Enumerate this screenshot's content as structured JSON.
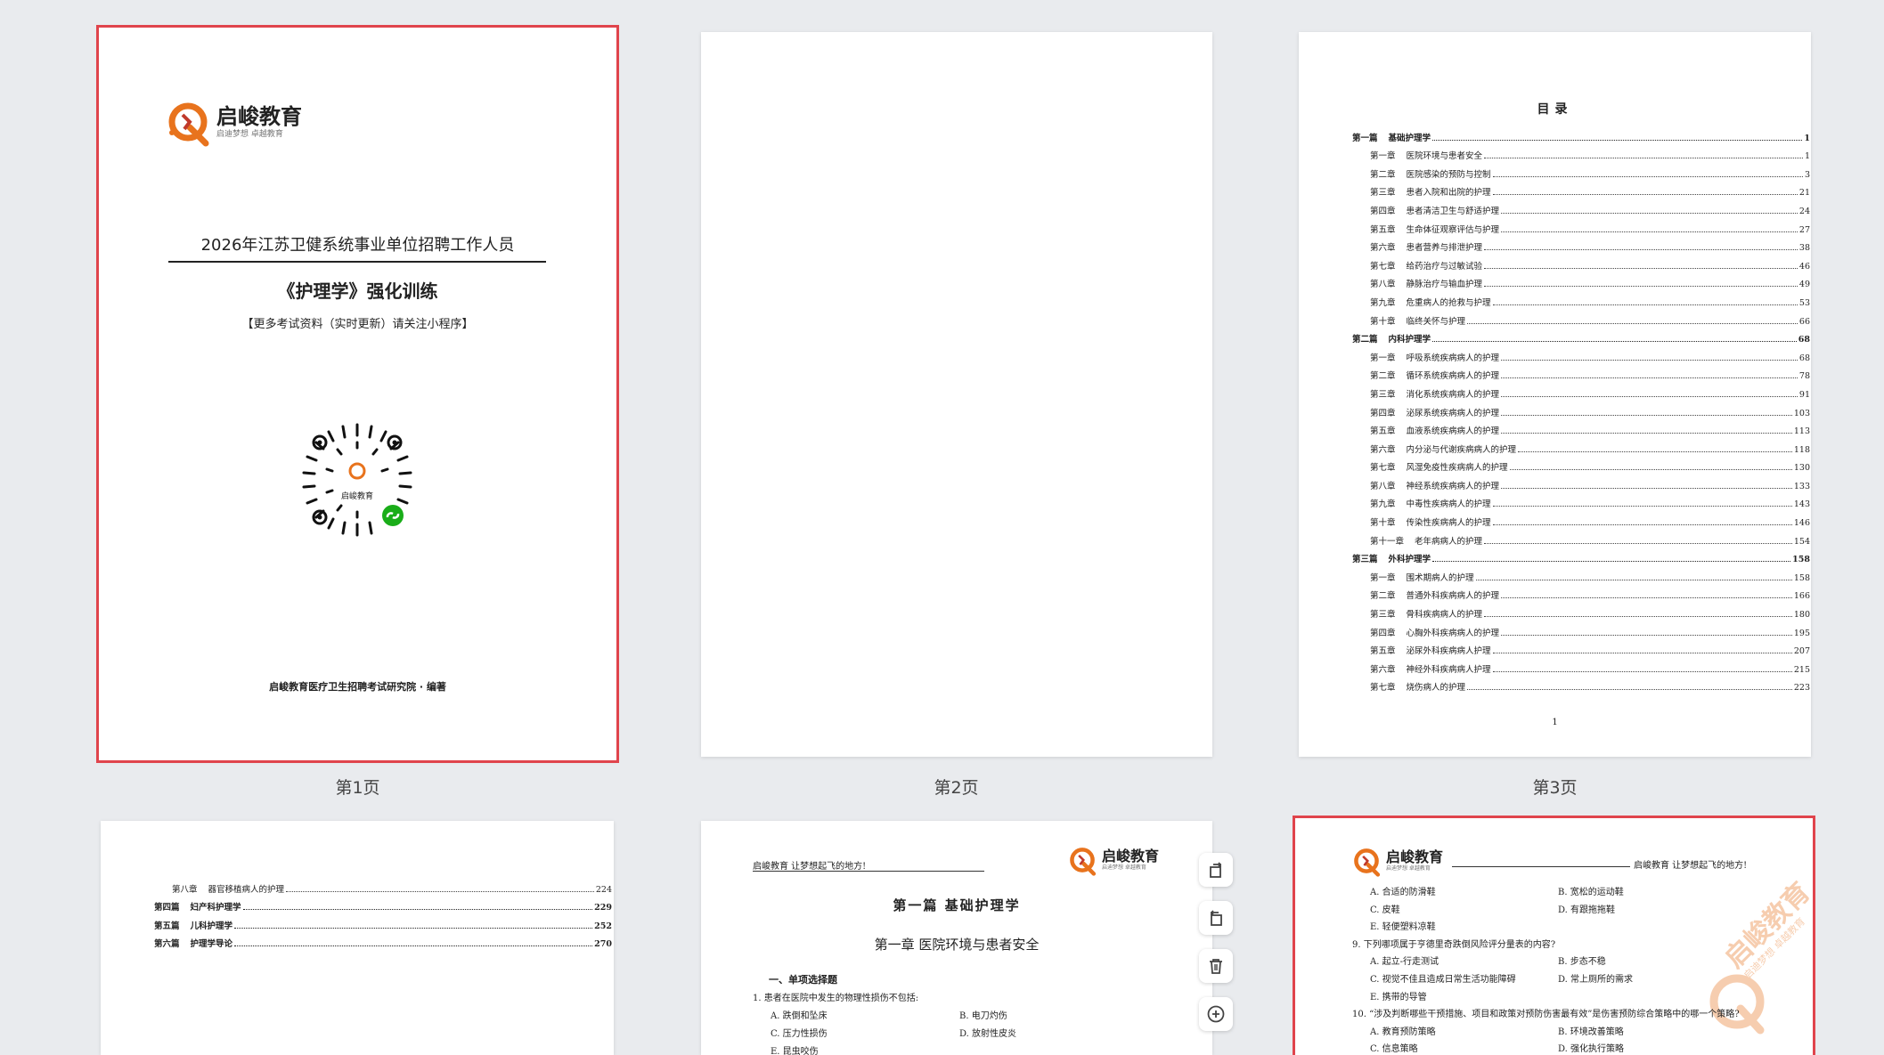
{
  "brand": {
    "name": "启峻教育",
    "slogan": "启迪梦想 卓越教育"
  },
  "pages": [
    {
      "label": "第1页"
    },
    {
      "label": "第2页"
    },
    {
      "label": "第3页"
    }
  ],
  "cover": {
    "title_line1": "2026年江苏卫健系统事业单位招聘工作人员",
    "title_line2": "《护理学》强化训练",
    "note": "【更多考试资料（实时更新）请关注小程序】",
    "qr_logo_text": "启峻教育",
    "publisher": "启峻教育医疗卫生招聘考试研究院 · 编著"
  },
  "toc": {
    "title": "目录",
    "page_number": "1",
    "entries": [
      {
        "type": "part",
        "k": "第一篇",
        "t": "基础护理学",
        "p": "1"
      },
      {
        "type": "chap",
        "k": "第一章",
        "t": "医院环境与患者安全",
        "p": "1"
      },
      {
        "type": "chap",
        "k": "第二章",
        "t": "医院感染的预防与控制",
        "p": "3"
      },
      {
        "type": "chap",
        "k": "第三章",
        "t": "患者入院和出院的护理",
        "p": "21"
      },
      {
        "type": "chap",
        "k": "第四章",
        "t": "患者清洁卫生与舒适护理",
        "p": "24"
      },
      {
        "type": "chap",
        "k": "第五章",
        "t": "生命体征观察评估与护理",
        "p": "27"
      },
      {
        "type": "chap",
        "k": "第六章",
        "t": "患者营养与排泄护理",
        "p": "38"
      },
      {
        "type": "chap",
        "k": "第七章",
        "t": "给药治疗与过敏试验",
        "p": "46"
      },
      {
        "type": "chap",
        "k": "第八章",
        "t": "静脉治疗与输血护理",
        "p": "49"
      },
      {
        "type": "chap",
        "k": "第九章",
        "t": "危重病人的抢救与护理",
        "p": "53"
      },
      {
        "type": "chap",
        "k": "第十章",
        "t": "临终关怀与护理",
        "p": "66"
      },
      {
        "type": "part",
        "k": "第二篇",
        "t": "内科护理学",
        "p": "68"
      },
      {
        "type": "chap",
        "k": "第一章",
        "t": "呼吸系统疾病病人的护理",
        "p": "68"
      },
      {
        "type": "chap",
        "k": "第二章",
        "t": "循环系统疾病病人的护理",
        "p": "78"
      },
      {
        "type": "chap",
        "k": "第三章",
        "t": "消化系统疾病病人的护理",
        "p": "91"
      },
      {
        "type": "chap",
        "k": "第四章",
        "t": "泌尿系统疾病病人的护理",
        "p": "103"
      },
      {
        "type": "chap",
        "k": "第五章",
        "t": "血液系统疾病病人的护理",
        "p": "113"
      },
      {
        "type": "chap",
        "k": "第六章",
        "t": "内分泌与代谢疾病病人的护理",
        "p": "118"
      },
      {
        "type": "chap",
        "k": "第七章",
        "t": "风湿免疫性疾病病人的护理",
        "p": "130"
      },
      {
        "type": "chap",
        "k": "第八章",
        "t": "神经系统疾病病人的护理",
        "p": "133"
      },
      {
        "type": "chap",
        "k": "第九章",
        "t": "中毒性疾病病人的护理",
        "p": "143"
      },
      {
        "type": "chap",
        "k": "第十章",
        "t": "传染性疾病病人的护理",
        "p": "146"
      },
      {
        "type": "chap",
        "k": "第十一章",
        "t": "老年病病人的护理",
        "p": "154"
      },
      {
        "type": "part",
        "k": "第三篇",
        "t": "外科护理学",
        "p": "158"
      },
      {
        "type": "chap",
        "k": "第一章",
        "t": "围术期病人的护理",
        "p": "158"
      },
      {
        "type": "chap",
        "k": "第二章",
        "t": "普通外科疾病病人的护理",
        "p": "166"
      },
      {
        "type": "chap",
        "k": "第三章",
        "t": "骨科疾病病人的护理",
        "p": "180"
      },
      {
        "type": "chap",
        "k": "第四章",
        "t": "心胸外科疾病病人的护理",
        "p": "195"
      },
      {
        "type": "chap",
        "k": "第五章",
        "t": "泌尿外科疾病病人护理",
        "p": "207"
      },
      {
        "type": "chap",
        "k": "第六章",
        "t": "神经外科疾病病人护理",
        "p": "215"
      },
      {
        "type": "chap",
        "k": "第七章",
        "t": "烧伤病人的护理",
        "p": "223"
      }
    ]
  },
  "toc2": {
    "entries": [
      {
        "type": "chap",
        "k": "第八章",
        "t": "器官移植病人的护理",
        "p": "224"
      },
      {
        "type": "part",
        "k": "第四篇",
        "t": "妇产科护理学",
        "p": "229"
      },
      {
        "type": "part",
        "k": "第五篇",
        "t": "儿科护理学",
        "p": "252"
      },
      {
        "type": "part",
        "k": "第六篇",
        "t": "护理学导论",
        "p": "270"
      }
    ]
  },
  "page5": {
    "header_slogan": "启峻教育  让梦想起飞的地方!",
    "part_title": "第一篇   基础护理学",
    "chapter_title": "第一章   医院环境与患者安全",
    "section": "一、单项选择题",
    "q1": "1.    患者在医院中发生的物理性损伤不包括:",
    "opts": [
      "A. 跌倒和坠床",
      "B. 电刀灼伤",
      "C. 压力性损伤",
      "D. 放射性皮炎",
      "E. 昆虫咬伤"
    ]
  },
  "page6": {
    "header_slogan": "启峻教育  让梦想起飞的地方!",
    "lines": [
      [
        "A. 合适的防滑鞋",
        "B. 宽松的运动鞋"
      ],
      [
        "C. 皮鞋",
        "D. 有跟拖拖鞋"
      ],
      [
        "E. 轻便塑料凉鞋",
        ""
      ],
      [
        "9.    下列哪项属于亨德里奇跌倒风险评分量表的内容?",
        ""
      ],
      [
        "A. 起立-行走测试",
        "B. 步态不稳"
      ],
      [
        "C. 视觉不佳且造成日常生活功能障碍",
        "D. 常上厕所的需求"
      ],
      [
        "E. 携带的导管",
        ""
      ],
      [
        "10.   “涉及判断哪些干预措施、项目和政策对预防伤害最有效”是伤害预防综合策略中的哪一个策略?",
        ""
      ],
      [
        "A. 教育预防策略",
        "B. 环境改善策略"
      ],
      [
        "C. 信息策略",
        "D. 强化执行策略"
      ]
    ]
  },
  "watermark_text": "启峻教育",
  "watermark_sub": "启迪梦想 卓越教育",
  "tools": [
    "rotate-left-icon",
    "rotate-right-icon",
    "delete-icon",
    "add-icon"
  ]
}
